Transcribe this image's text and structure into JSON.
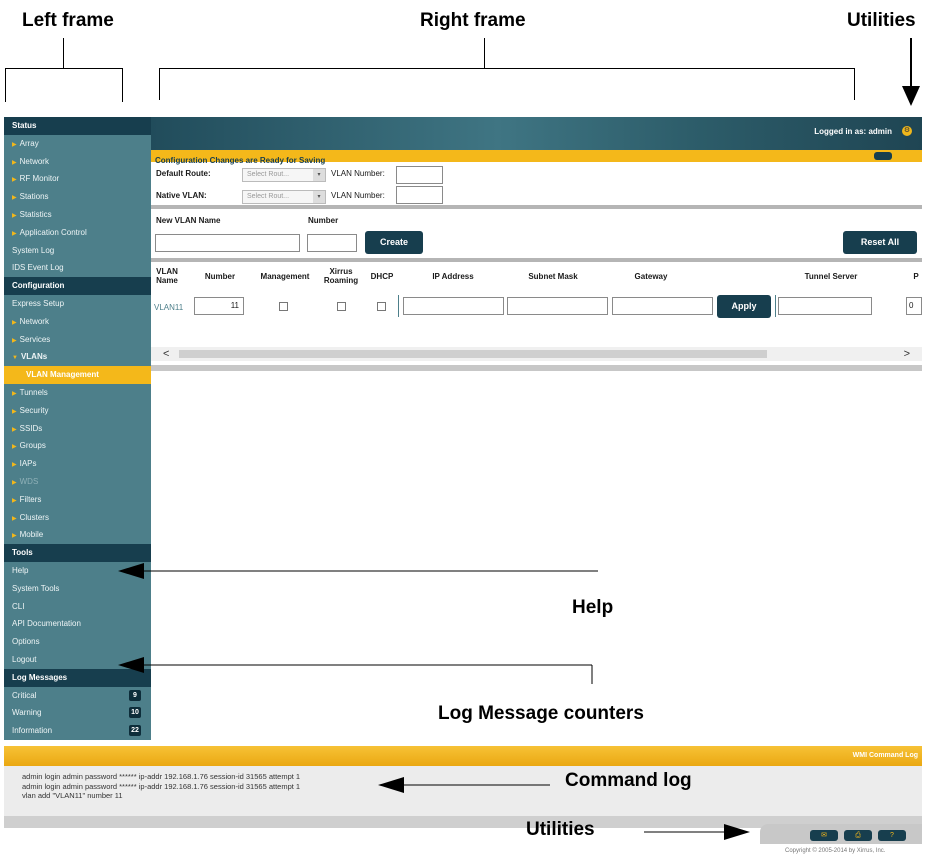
{
  "callouts": {
    "left_frame": "Left frame",
    "right_frame": "Right frame",
    "utilities_top": "Utilities",
    "help": "Help",
    "log_counters": "Log Message counters",
    "command_log": "Command log",
    "utilities_bottom": "Utilities"
  },
  "sidebar": {
    "items": [
      {
        "label": "Status",
        "kind": "header"
      },
      {
        "label": "Array",
        "kind": "arrow"
      },
      {
        "label": "Network",
        "kind": "arrow"
      },
      {
        "label": "RF Monitor",
        "kind": "arrow"
      },
      {
        "label": "Stations",
        "kind": "arrow"
      },
      {
        "label": "Statistics",
        "kind": "arrow"
      },
      {
        "label": "Application Control",
        "kind": "arrow"
      },
      {
        "label": "System Log",
        "kind": "plain"
      },
      {
        "label": "IDS Event Log",
        "kind": "plain"
      },
      {
        "label": "Configuration",
        "kind": "header"
      },
      {
        "label": "Express Setup",
        "kind": "plain"
      },
      {
        "label": "Network",
        "kind": "arrow"
      },
      {
        "label": "Services",
        "kind": "arrow"
      },
      {
        "label": "VLANs",
        "kind": "open"
      },
      {
        "label": "VLAN Management",
        "kind": "active"
      },
      {
        "label": "Tunnels",
        "kind": "arrow"
      },
      {
        "label": "Security",
        "kind": "arrow"
      },
      {
        "label": "SSIDs",
        "kind": "arrow"
      },
      {
        "label": "Groups",
        "kind": "arrow"
      },
      {
        "label": "IAPs",
        "kind": "arrow"
      },
      {
        "label": "WDS",
        "kind": "dim"
      },
      {
        "label": "Filters",
        "kind": "arrow"
      },
      {
        "label": "Clusters",
        "kind": "arrow"
      },
      {
        "label": "Mobile",
        "kind": "arrow"
      },
      {
        "label": "Tools",
        "kind": "header"
      },
      {
        "label": "Help",
        "kind": "plain"
      },
      {
        "label": "System Tools",
        "kind": "plain"
      },
      {
        "label": "CLI",
        "kind": "plain"
      },
      {
        "label": "API Documentation",
        "kind": "plain"
      },
      {
        "label": "Options",
        "kind": "plain"
      },
      {
        "label": "Logout",
        "kind": "plain"
      },
      {
        "label": "Log Messages",
        "kind": "header"
      },
      {
        "label": "Critical",
        "kind": "count",
        "count": "9"
      },
      {
        "label": "Warning",
        "kind": "count",
        "count": "10"
      },
      {
        "label": "Information",
        "kind": "count",
        "count": "22"
      }
    ]
  },
  "header": {
    "logged_in": "Logged in as: admin",
    "config_message": "Configuration Changes are Ready for Saving"
  },
  "routes": {
    "default_route_label": "Default Route:",
    "native_vlan_label": "Native VLAN:",
    "select_placeholder": "Select Rout...",
    "vlan_number_label": "VLAN Number:"
  },
  "new_vlan": {
    "name_label": "New VLAN Name",
    "number_label": "Number",
    "create_button": "Create",
    "reset_button": "Reset All"
  },
  "table": {
    "headers": [
      "VLAN Name",
      "Number",
      "Management",
      "Xirrus Roaming",
      "DHCP",
      "IP Address",
      "Subnet Mask",
      "Gateway",
      "Tunnel Server",
      "P"
    ],
    "row": {
      "name": "VLAN11",
      "number": "11",
      "apply": "Apply",
      "tail_value": "0"
    }
  },
  "scrollbar": {
    "left": "<",
    "right": ">"
  },
  "command_log": {
    "title": "WMI Command Log",
    "lines": [
      "admin login admin password ****** ip-addr 192.168.1.76 session-id 31565 attempt 1",
      "admin login admin password ****** ip-addr 192.168.1.76 session-id 31565 attempt 1",
      "vlan add \"VLAN11\" number 11"
    ]
  },
  "utilities": {
    "button_icons": [
      "mail-icon",
      "print-icon",
      "help-icon"
    ],
    "help_label": "?"
  },
  "footer": {
    "copyright": "Copyright © 2005-2014 by Xirrus, Inc."
  },
  "colors": {
    "sidebar_bg": "#4d7f8a",
    "header_navy": "#173e4e",
    "accent_yellow": "#f4b81a"
  }
}
